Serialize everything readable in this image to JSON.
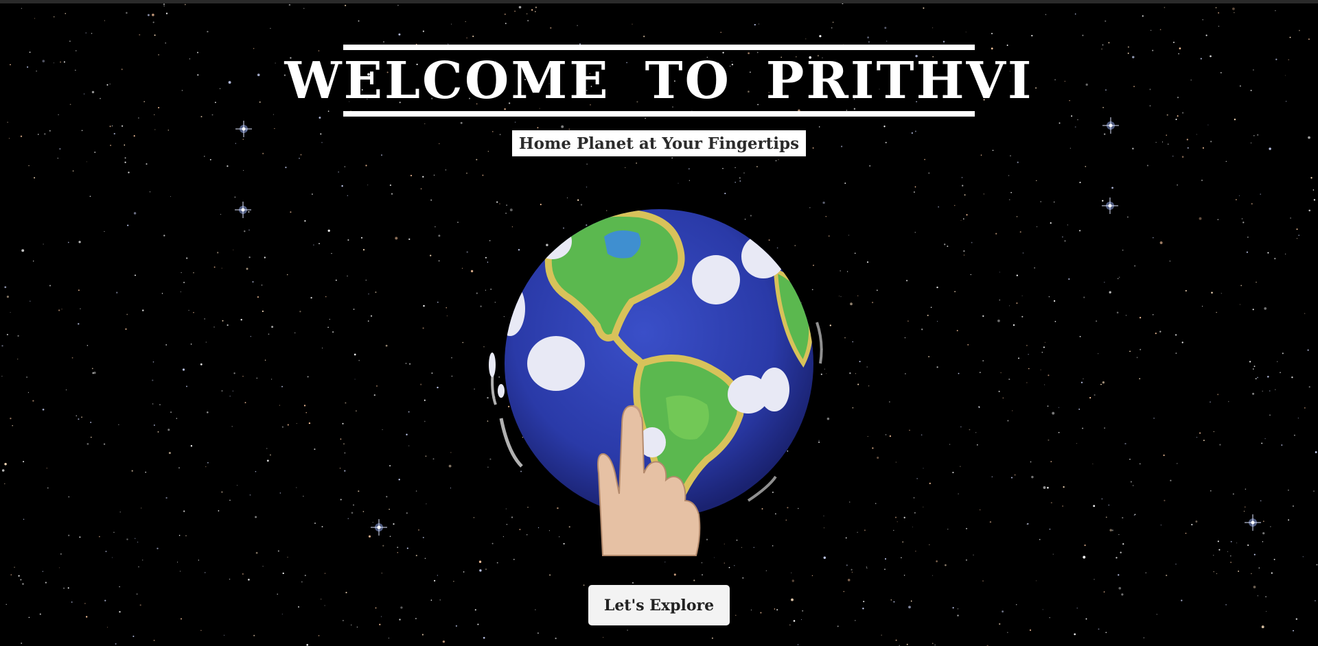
{
  "hero": {
    "title": "WELCOME TO PRITHVI",
    "tagline": "Home Planet at Your Fingertips"
  },
  "illustration": {
    "subject": "earth-globe-with-pointing-hand"
  },
  "actions": {
    "explore_label": "Let's Explore"
  },
  "colors": {
    "background": "#000000",
    "title_text": "#ffffff",
    "tagline_bg": "#ffffff",
    "tagline_text": "#2b2b2b",
    "button_bg": "#f3f3f3",
    "ocean": "#2a3aa8",
    "land": "#5bb84f",
    "land_edge": "#d8c25a"
  }
}
